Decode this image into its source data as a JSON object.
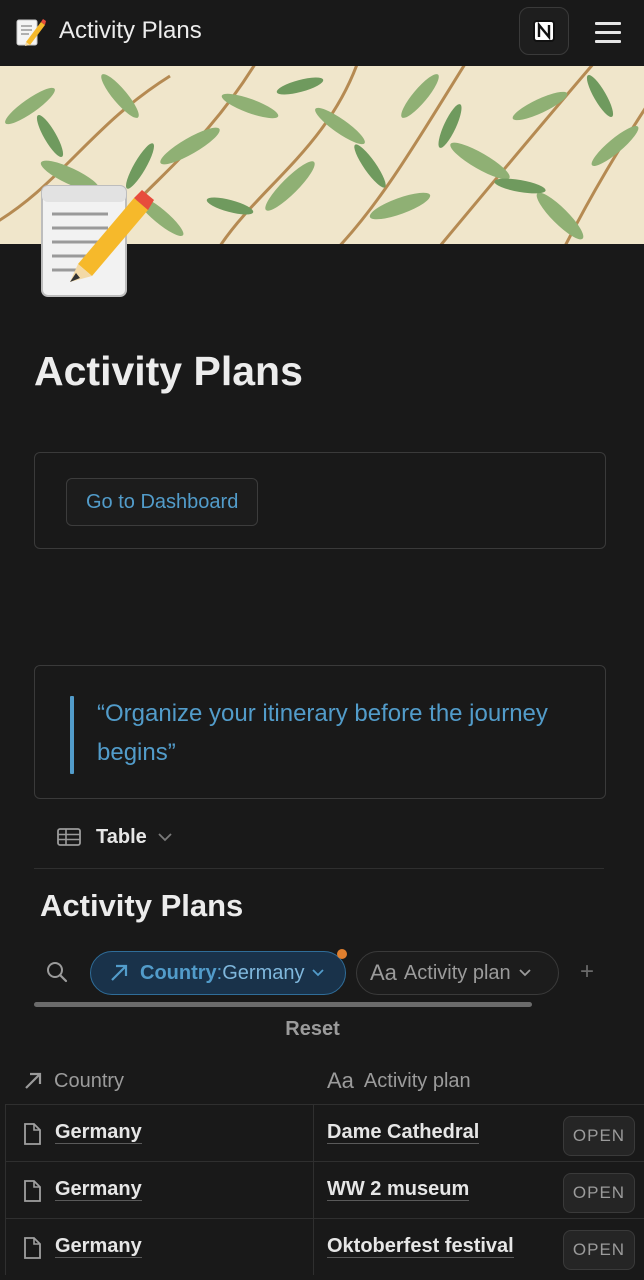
{
  "topbar": {
    "app_icon": "memo-pencil-icon",
    "title": "Activity Plans",
    "notion_icon": "notion-logo-icon",
    "menu_icon": "hamburger-menu-icon"
  },
  "page": {
    "icon": "memo-pencil-icon",
    "title": "Activity Plans"
  },
  "dashboard_button": {
    "label": "Go to Dashboard"
  },
  "quote": {
    "text": "“Organize your itinerary before the journey begins”"
  },
  "view_tab": {
    "icon": "table-icon",
    "label": "Table"
  },
  "database": {
    "title": "Activity Plans",
    "filter": {
      "property": "Country",
      "separator": ":",
      "value": " Germany",
      "indicator_color": "#e07f2e"
    },
    "sort_chip": {
      "aa": "Aa",
      "label": "Activity plan"
    },
    "add_label": "+",
    "reset_label": "Reset",
    "columns": [
      {
        "icon": "relation-arrow-icon",
        "label": "Country"
      },
      {
        "icon": "title-aa-icon",
        "label": "Activity plan",
        "aa": "Aa"
      }
    ],
    "rows": [
      {
        "country": "Germany",
        "plan": "Dame Cathedral",
        "open": "OPEN"
      },
      {
        "country": "Germany",
        "plan": "WW 2 museum",
        "open": "OPEN"
      },
      {
        "country": "Germany",
        "plan": "Oktoberfest festival",
        "open": "OPEN"
      }
    ]
  },
  "colors": {
    "background": "#191919",
    "accent_blue": "#529cca",
    "border": "#3a3a3a"
  }
}
